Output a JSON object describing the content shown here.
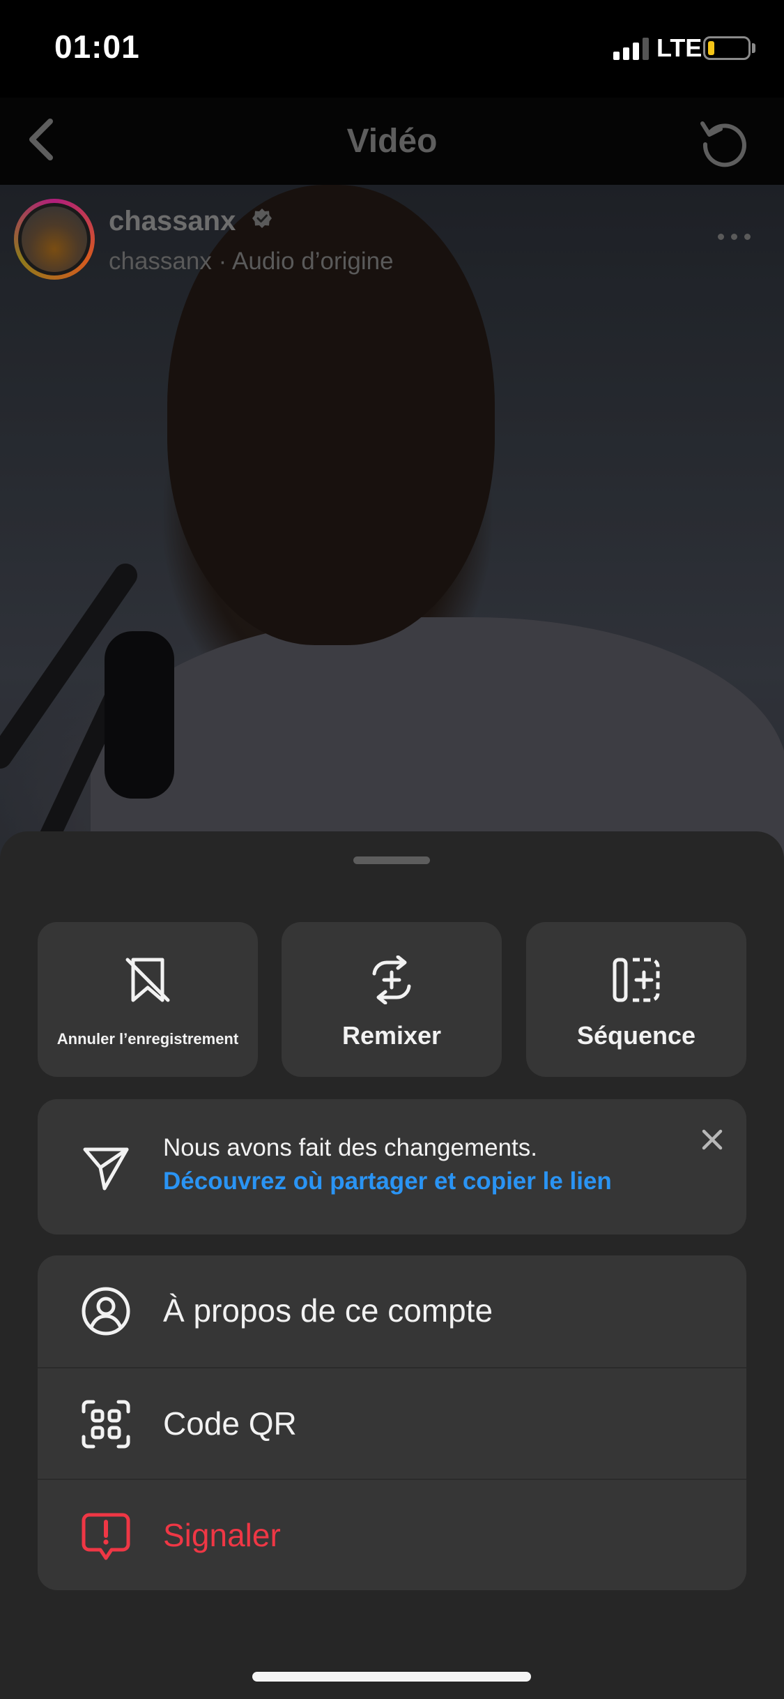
{
  "status_bar": {
    "time": "01:01",
    "network": "LTE",
    "battery_color": "#f5c518"
  },
  "nav": {
    "title": "Vidéo"
  },
  "post": {
    "username": "chassanx",
    "subline": "chassanx · Audio d’origine"
  },
  "actions": [
    {
      "label": "Annuler l’enregistrement",
      "icon": "bookmark-remove-icon"
    },
    {
      "label": "Remixer",
      "icon": "remix-icon"
    },
    {
      "label": "Séquence",
      "icon": "sequence-icon"
    }
  ],
  "notice": {
    "title": "Nous avons fait des changements.",
    "link": "Découvrez où partager et copier le lien",
    "link_color": "#2a94f4",
    "icon": "send-icon"
  },
  "menu": [
    {
      "label": "À propos de ce compte",
      "icon": "account-icon"
    },
    {
      "label": "Code QR",
      "icon": "qr-code-icon"
    },
    {
      "label": "Signaler",
      "icon": "report-icon",
      "color": "#ef3745"
    }
  ],
  "colors": {
    "sheet": "#262626",
    "tile": "#363636",
    "danger": "#ef3745"
  }
}
